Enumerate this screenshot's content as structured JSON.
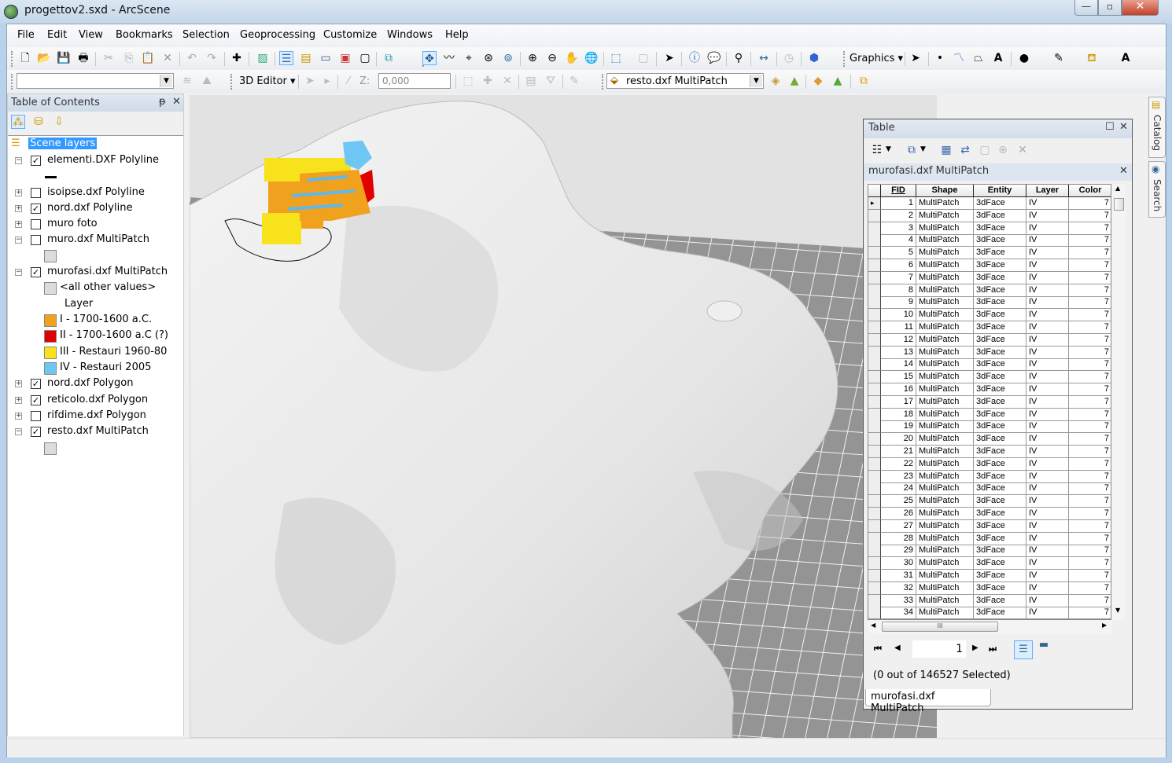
{
  "window": {
    "title": "progettov2.sxd - ArcScene",
    "minimize": "—",
    "maximize": "▫",
    "close": "✕"
  },
  "menu": [
    "File",
    "Edit",
    "View",
    "Bookmarks",
    "Selection",
    "Geoprocessing",
    "Customize",
    "Windows",
    "Help"
  ],
  "toolbar2": {
    "editor_label": "3D Editor ▾",
    "z_label": "Z:",
    "z_value": "0,000",
    "layer_select": "resto.dxf MultiPatch",
    "graphics_label": "Graphics ▾"
  },
  "toc": {
    "title": "Table of Contents",
    "pin": "ᵽ",
    "close": "✕",
    "root": "Scene layers",
    "layers": [
      {
        "name": "elementi.DXF Polyline",
        "checked": true,
        "expanded": true
      },
      {
        "name": "isoipse.dxf Polyline",
        "checked": false,
        "expanded": false
      },
      {
        "name": "nord.dxf Polyline",
        "checked": true,
        "expanded": false
      },
      {
        "name": "muro foto",
        "checked": false,
        "expanded": false
      },
      {
        "name": "muro.dxf MultiPatch",
        "checked": false,
        "expanded": true
      },
      {
        "name": "murofasi.dxf MultiPatch",
        "checked": true,
        "expanded": true
      },
      {
        "name": "nord.dxf Polygon",
        "checked": true,
        "expanded": false
      },
      {
        "name": "reticolo.dxf Polygon",
        "checked": true,
        "expanded": false
      },
      {
        "name": "rifdime.dxf Polygon",
        "checked": false,
        "expanded": false
      },
      {
        "name": "resto.dxf MultiPatch",
        "checked": true,
        "expanded": true
      }
    ],
    "murofasi_legend": {
      "other": "<all other values>",
      "field": "Layer",
      "classes": [
        {
          "label": "I - 1700-1600 a.C.",
          "color": "#f0a21e"
        },
        {
          "label": "II - 1700-1600 a.C (?)",
          "color": "#e00000"
        },
        {
          "label": "III - Restauri 1960-80",
          "color": "#f8e21c"
        },
        {
          "label": "IV - Restauri 2005",
          "color": "#6ec6f5"
        }
      ]
    }
  },
  "table": {
    "title": "Table",
    "tab_name": "murofasi.dxf MultiPatch",
    "columns": [
      "FID",
      "Shape",
      "Entity",
      "Layer",
      "Color"
    ],
    "rows": [
      [
        1,
        "MultiPatch",
        "3dFace",
        "IV",
        7
      ],
      [
        2,
        "MultiPatch",
        "3dFace",
        "IV",
        7
      ],
      [
        3,
        "MultiPatch",
        "3dFace",
        "IV",
        7
      ],
      [
        4,
        "MultiPatch",
        "3dFace",
        "IV",
        7
      ],
      [
        5,
        "MultiPatch",
        "3dFace",
        "IV",
        7
      ],
      [
        6,
        "MultiPatch",
        "3dFace",
        "IV",
        7
      ],
      [
        7,
        "MultiPatch",
        "3dFace",
        "IV",
        7
      ],
      [
        8,
        "MultiPatch",
        "3dFace",
        "IV",
        7
      ],
      [
        9,
        "MultiPatch",
        "3dFace",
        "IV",
        7
      ],
      [
        10,
        "MultiPatch",
        "3dFace",
        "IV",
        7
      ],
      [
        11,
        "MultiPatch",
        "3dFace",
        "IV",
        7
      ],
      [
        12,
        "MultiPatch",
        "3dFace",
        "IV",
        7
      ],
      [
        13,
        "MultiPatch",
        "3dFace",
        "IV",
        7
      ],
      [
        14,
        "MultiPatch",
        "3dFace",
        "IV",
        7
      ],
      [
        15,
        "MultiPatch",
        "3dFace",
        "IV",
        7
      ],
      [
        16,
        "MultiPatch",
        "3dFace",
        "IV",
        7
      ],
      [
        17,
        "MultiPatch",
        "3dFace",
        "IV",
        7
      ],
      [
        18,
        "MultiPatch",
        "3dFace",
        "IV",
        7
      ],
      [
        19,
        "MultiPatch",
        "3dFace",
        "IV",
        7
      ],
      [
        20,
        "MultiPatch",
        "3dFace",
        "IV",
        7
      ],
      [
        21,
        "MultiPatch",
        "3dFace",
        "IV",
        7
      ],
      [
        22,
        "MultiPatch",
        "3dFace",
        "IV",
        7
      ],
      [
        23,
        "MultiPatch",
        "3dFace",
        "IV",
        7
      ],
      [
        24,
        "MultiPatch",
        "3dFace",
        "IV",
        7
      ],
      [
        25,
        "MultiPatch",
        "3dFace",
        "IV",
        7
      ],
      [
        26,
        "MultiPatch",
        "3dFace",
        "IV",
        7
      ],
      [
        27,
        "MultiPatch",
        "3dFace",
        "IV",
        7
      ],
      [
        28,
        "MultiPatch",
        "3dFace",
        "IV",
        7
      ],
      [
        29,
        "MultiPatch",
        "3dFace",
        "IV",
        7
      ],
      [
        30,
        "MultiPatch",
        "3dFace",
        "IV",
        7
      ],
      [
        31,
        "MultiPatch",
        "3dFace",
        "IV",
        7
      ],
      [
        32,
        "MultiPatch",
        "3dFace",
        "IV",
        7
      ],
      [
        33,
        "MultiPatch",
        "3dFace",
        "IV",
        7
      ],
      [
        34,
        "MultiPatch",
        "3dFace",
        "IV",
        7
      ]
    ],
    "current_record": "1",
    "status": "(0 out of 146527 Selected)",
    "bottom_tab": "murofasi.dxf MultiPatch"
  },
  "dock": {
    "catalog": "Catalog",
    "search": "Search"
  }
}
